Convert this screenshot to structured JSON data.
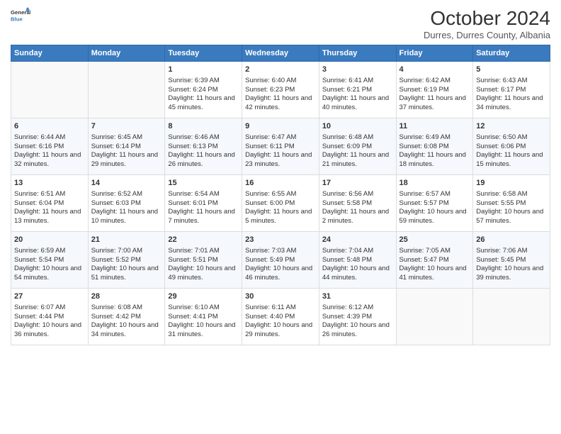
{
  "header": {
    "logo_line1": "General",
    "logo_line2": "Blue",
    "month": "October 2024",
    "location": "Durres, Durres County, Albania"
  },
  "weekdays": [
    "Sunday",
    "Monday",
    "Tuesday",
    "Wednesday",
    "Thursday",
    "Friday",
    "Saturday"
  ],
  "weeks": [
    [
      {
        "day": "",
        "sunrise": "",
        "sunset": "",
        "daylight": ""
      },
      {
        "day": "",
        "sunrise": "",
        "sunset": "",
        "daylight": ""
      },
      {
        "day": "1",
        "sunrise": "Sunrise: 6:39 AM",
        "sunset": "Sunset: 6:24 PM",
        "daylight": "Daylight: 11 hours and 45 minutes."
      },
      {
        "day": "2",
        "sunrise": "Sunrise: 6:40 AM",
        "sunset": "Sunset: 6:23 PM",
        "daylight": "Daylight: 11 hours and 42 minutes."
      },
      {
        "day": "3",
        "sunrise": "Sunrise: 6:41 AM",
        "sunset": "Sunset: 6:21 PM",
        "daylight": "Daylight: 11 hours and 40 minutes."
      },
      {
        "day": "4",
        "sunrise": "Sunrise: 6:42 AM",
        "sunset": "Sunset: 6:19 PM",
        "daylight": "Daylight: 11 hours and 37 minutes."
      },
      {
        "day": "5",
        "sunrise": "Sunrise: 6:43 AM",
        "sunset": "Sunset: 6:17 PM",
        "daylight": "Daylight: 11 hours and 34 minutes."
      }
    ],
    [
      {
        "day": "6",
        "sunrise": "Sunrise: 6:44 AM",
        "sunset": "Sunset: 6:16 PM",
        "daylight": "Daylight: 11 hours and 32 minutes."
      },
      {
        "day": "7",
        "sunrise": "Sunrise: 6:45 AM",
        "sunset": "Sunset: 6:14 PM",
        "daylight": "Daylight: 11 hours and 29 minutes."
      },
      {
        "day": "8",
        "sunrise": "Sunrise: 6:46 AM",
        "sunset": "Sunset: 6:13 PM",
        "daylight": "Daylight: 11 hours and 26 minutes."
      },
      {
        "day": "9",
        "sunrise": "Sunrise: 6:47 AM",
        "sunset": "Sunset: 6:11 PM",
        "daylight": "Daylight: 11 hours and 23 minutes."
      },
      {
        "day": "10",
        "sunrise": "Sunrise: 6:48 AM",
        "sunset": "Sunset: 6:09 PM",
        "daylight": "Daylight: 11 hours and 21 minutes."
      },
      {
        "day": "11",
        "sunrise": "Sunrise: 6:49 AM",
        "sunset": "Sunset: 6:08 PM",
        "daylight": "Daylight: 11 hours and 18 minutes."
      },
      {
        "day": "12",
        "sunrise": "Sunrise: 6:50 AM",
        "sunset": "Sunset: 6:06 PM",
        "daylight": "Daylight: 11 hours and 15 minutes."
      }
    ],
    [
      {
        "day": "13",
        "sunrise": "Sunrise: 6:51 AM",
        "sunset": "Sunset: 6:04 PM",
        "daylight": "Daylight: 11 hours and 13 minutes."
      },
      {
        "day": "14",
        "sunrise": "Sunrise: 6:52 AM",
        "sunset": "Sunset: 6:03 PM",
        "daylight": "Daylight: 11 hours and 10 minutes."
      },
      {
        "day": "15",
        "sunrise": "Sunrise: 6:54 AM",
        "sunset": "Sunset: 6:01 PM",
        "daylight": "Daylight: 11 hours and 7 minutes."
      },
      {
        "day": "16",
        "sunrise": "Sunrise: 6:55 AM",
        "sunset": "Sunset: 6:00 PM",
        "daylight": "Daylight: 11 hours and 5 minutes."
      },
      {
        "day": "17",
        "sunrise": "Sunrise: 6:56 AM",
        "sunset": "Sunset: 5:58 PM",
        "daylight": "Daylight: 11 hours and 2 minutes."
      },
      {
        "day": "18",
        "sunrise": "Sunrise: 6:57 AM",
        "sunset": "Sunset: 5:57 PM",
        "daylight": "Daylight: 10 hours and 59 minutes."
      },
      {
        "day": "19",
        "sunrise": "Sunrise: 6:58 AM",
        "sunset": "Sunset: 5:55 PM",
        "daylight": "Daylight: 10 hours and 57 minutes."
      }
    ],
    [
      {
        "day": "20",
        "sunrise": "Sunrise: 6:59 AM",
        "sunset": "Sunset: 5:54 PM",
        "daylight": "Daylight: 10 hours and 54 minutes."
      },
      {
        "day": "21",
        "sunrise": "Sunrise: 7:00 AM",
        "sunset": "Sunset: 5:52 PM",
        "daylight": "Daylight: 10 hours and 51 minutes."
      },
      {
        "day": "22",
        "sunrise": "Sunrise: 7:01 AM",
        "sunset": "Sunset: 5:51 PM",
        "daylight": "Daylight: 10 hours and 49 minutes."
      },
      {
        "day": "23",
        "sunrise": "Sunrise: 7:03 AM",
        "sunset": "Sunset: 5:49 PM",
        "daylight": "Daylight: 10 hours and 46 minutes."
      },
      {
        "day": "24",
        "sunrise": "Sunrise: 7:04 AM",
        "sunset": "Sunset: 5:48 PM",
        "daylight": "Daylight: 10 hours and 44 minutes."
      },
      {
        "day": "25",
        "sunrise": "Sunrise: 7:05 AM",
        "sunset": "Sunset: 5:47 PM",
        "daylight": "Daylight: 10 hours and 41 minutes."
      },
      {
        "day": "26",
        "sunrise": "Sunrise: 7:06 AM",
        "sunset": "Sunset: 5:45 PM",
        "daylight": "Daylight: 10 hours and 39 minutes."
      }
    ],
    [
      {
        "day": "27",
        "sunrise": "Sunrise: 6:07 AM",
        "sunset": "Sunset: 4:44 PM",
        "daylight": "Daylight: 10 hours and 36 minutes."
      },
      {
        "day": "28",
        "sunrise": "Sunrise: 6:08 AM",
        "sunset": "Sunset: 4:42 PM",
        "daylight": "Daylight: 10 hours and 34 minutes."
      },
      {
        "day": "29",
        "sunrise": "Sunrise: 6:10 AM",
        "sunset": "Sunset: 4:41 PM",
        "daylight": "Daylight: 10 hours and 31 minutes."
      },
      {
        "day": "30",
        "sunrise": "Sunrise: 6:11 AM",
        "sunset": "Sunset: 4:40 PM",
        "daylight": "Daylight: 10 hours and 29 minutes."
      },
      {
        "day": "31",
        "sunrise": "Sunrise: 6:12 AM",
        "sunset": "Sunset: 4:39 PM",
        "daylight": "Daylight: 10 hours and 26 minutes."
      },
      {
        "day": "",
        "sunrise": "",
        "sunset": "",
        "daylight": ""
      },
      {
        "day": "",
        "sunrise": "",
        "sunset": "",
        "daylight": ""
      }
    ]
  ]
}
